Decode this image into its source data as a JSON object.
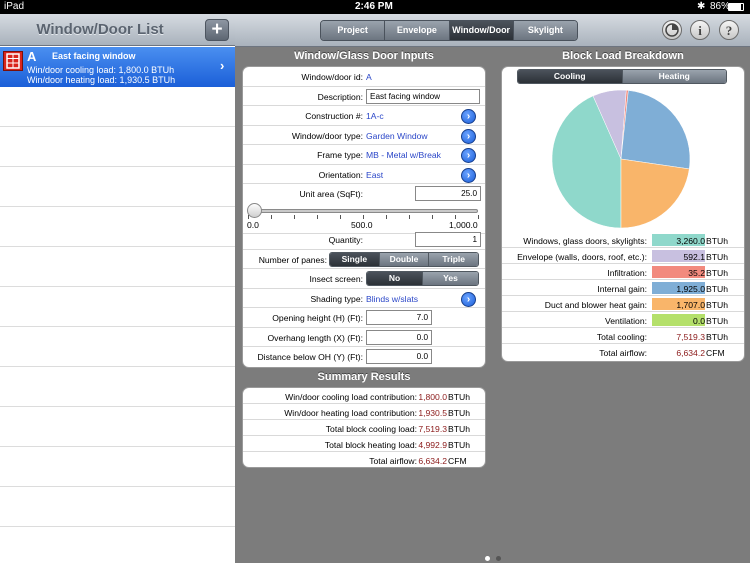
{
  "status": {
    "device": "iPad",
    "time": "2:46 PM",
    "battery": "86%",
    "bluetooth_icon": "bluetooth-icon",
    "battery_icon": "battery-icon"
  },
  "sidebar": {
    "title": "Window/Door List",
    "add_label": "+",
    "selected": {
      "id": "A",
      "name": "East facing window",
      "cooling": "Win/door cooling load: 1,800.0 BTUh",
      "heating": "Win/door heating load: 1,930.5 BTUh"
    }
  },
  "tabs": [
    {
      "label": "Project"
    },
    {
      "label": "Envelope"
    },
    {
      "label": "Window/Door",
      "selected": true
    },
    {
      "label": "Skylight"
    }
  ],
  "top_icons": [
    "pie-chart-icon",
    "info-icon",
    "help-icon"
  ],
  "inputs": {
    "title": "Window/Glass Door Inputs",
    "id_label": "Window/door id:",
    "id_value": "A",
    "desc_label": "Description:",
    "desc_value": "East facing window",
    "construction_label": "Construction #:",
    "construction_value": "1A-c",
    "type_label": "Window/door type:",
    "type_value": "Garden Window",
    "frame_label": "Frame type:",
    "frame_value": "MB - Metal w/Break",
    "orient_label": "Orientation:",
    "orient_value": "East",
    "area_label": "Unit area (SqFt):",
    "area_value": "25.0",
    "slider": {
      "min_label": "0.0",
      "mid_label": "500.0",
      "max_label": "1,000.0",
      "value_fraction": 0.025
    },
    "qty_label": "Quantity:",
    "qty_value": "1",
    "panes_label": "Number of panes:",
    "panes_options": [
      "Single",
      "Double",
      "Triple"
    ],
    "insect_label": "Insect screen:",
    "insect_options": [
      "No",
      "Yes"
    ],
    "shading_label": "Shading type:",
    "shading_value": "Blinds w/slats",
    "opening_label": "Opening height (H) (Ft):",
    "opening_value": "7.0",
    "overhang_label": "Overhang length (X) (Ft):",
    "overhang_value": "0.0",
    "below_label": "Distance below OH (Y) (Ft):",
    "below_value": "0.0"
  },
  "summary": {
    "title": "Summary Results",
    "rows": [
      {
        "label": "Win/door cooling load contribution:",
        "value": "1,800.0",
        "unit": "BTUh"
      },
      {
        "label": "Win/door heating load contribution:",
        "value": "1,930.5",
        "unit": "BTUh"
      },
      {
        "label": "Total block cooling load:",
        "value": "7,519.3",
        "unit": "BTUh"
      },
      {
        "label": "Total block heating load:",
        "value": "4,992.9",
        "unit": "BTUh"
      },
      {
        "label": "Total airflow:",
        "value": "6,634.2",
        "unit": "CFM"
      }
    ]
  },
  "breakdown": {
    "title": "Block Load Breakdown",
    "tabs": [
      "Cooling",
      "Heating"
    ],
    "rows": [
      {
        "label": "Windows, glass doors, skylights:",
        "value": "3,260.0",
        "unit": "BTUh",
        "color": "#8fd8cb"
      },
      {
        "label": "Envelope (walls, doors, roof, etc.):",
        "value": "592.1",
        "unit": "BTUh",
        "color": "#c8c0e0"
      },
      {
        "label": "Infiltration:",
        "value": "35.2",
        "unit": "BTUh",
        "color": "#f28a7e"
      },
      {
        "label": "Internal gain:",
        "value": "1,925.0",
        "unit": "BTUh",
        "color": "#7faed6"
      },
      {
        "label": "Duct and blower heat gain:",
        "value": "1,707.0",
        "unit": "BTUh",
        "color": "#f9b56a"
      },
      {
        "label": "Ventilation:",
        "value": "0.0",
        "unit": "BTUh",
        "color": "#b4e06a"
      },
      {
        "label": "Total cooling:",
        "value": "7,519.3",
        "unit": "BTUh"
      },
      {
        "label": "Total airflow:",
        "value": "6,634.2",
        "unit": "CFM"
      }
    ]
  },
  "chart_data": {
    "type": "pie",
    "categories": [
      "Windows, glass doors, skylights",
      "Envelope (walls, doors, roof, etc.)",
      "Infiltration",
      "Internal gain",
      "Duct and blower heat gain",
      "Ventilation"
    ],
    "values": [
      3260.0,
      592.1,
      35.2,
      1925.0,
      1707.0,
      0.0
    ],
    "colors": [
      "#8fd8cb",
      "#c8c0e0",
      "#f28a7e",
      "#7faed6",
      "#f9b56a",
      "#b4e06a"
    ]
  }
}
